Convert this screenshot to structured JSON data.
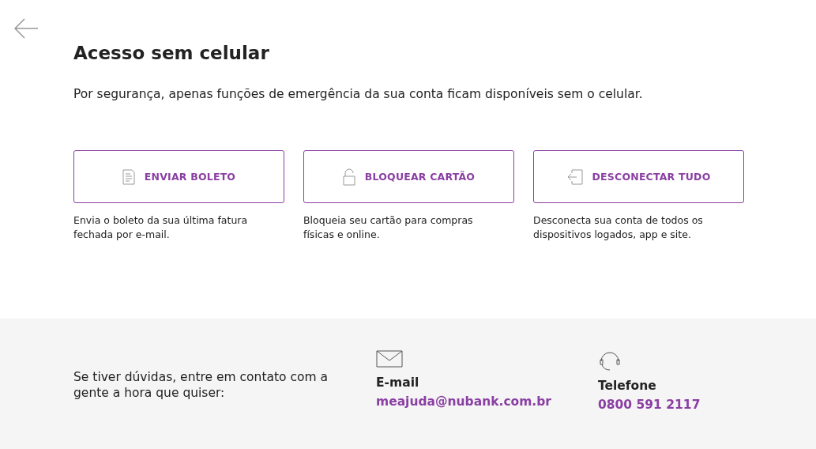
{
  "title": "Acesso sem celular",
  "intro": "Por segurança, apenas funções de emergência da sua conta ficam disponíveis sem o celular.",
  "actions": [
    {
      "kind": "document",
      "label": "ENVIAR BOLETO",
      "description": "Envia o boleto da sua última fatura fechada por e-mail."
    },
    {
      "kind": "lock",
      "label": "BLOQUEAR CARTÃO",
      "description": "Bloqueia seu cartão para compras físicas e online."
    },
    {
      "kind": "logout",
      "label": "DESCONECTAR TUDO",
      "description": "Desconecta sua conta de todos os dispositivos logados, app e site."
    }
  ],
  "footer": {
    "text": "Se tiver dúvidas, entre em contato com a gente a hora que quiser:",
    "contacts": [
      {
        "kind": "email",
        "label": "E-mail",
        "value": "meajuda@nubank.com.br"
      },
      {
        "kind": "phone",
        "label": "Telefone",
        "value": "0800 591 2117"
      }
    ]
  }
}
